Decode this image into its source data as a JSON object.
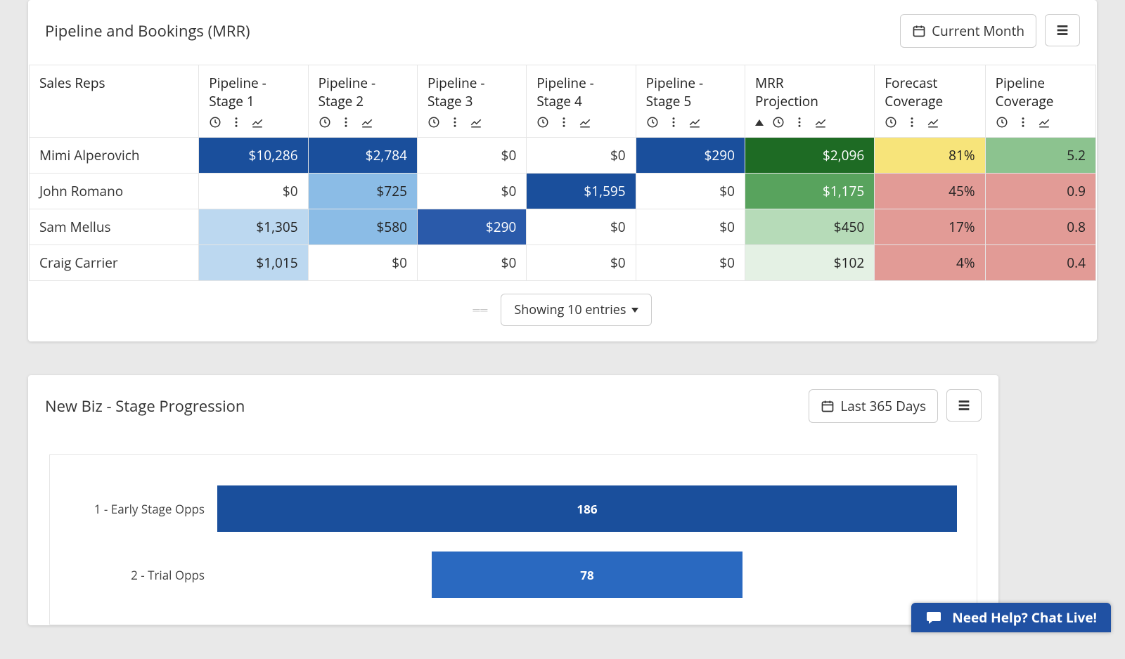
{
  "panel1": {
    "title": "Pipeline and Bookings (MRR)",
    "period": "Current Month",
    "entries_label": "Showing 10 entries",
    "columns": [
      {
        "label": "Sales Reps"
      },
      {
        "label": "Pipeline - Stage 1"
      },
      {
        "label": "Pipeline - Stage 2"
      },
      {
        "label": "Pipeline - Stage 3"
      },
      {
        "label": "Pipeline - Stage 4"
      },
      {
        "label": "Pipeline - Stage 5"
      },
      {
        "label": "MRR Projection",
        "sorted": "asc"
      },
      {
        "label": "Forecast Coverage"
      },
      {
        "label": "Pipeline Coverage"
      }
    ],
    "rows": [
      {
        "name": "Mimi Alperovich",
        "cells": [
          {
            "v": "$10,286",
            "c": "blue-dk"
          },
          {
            "v": "$2,784",
            "c": "blue-dk"
          },
          {
            "v": "$0",
            "c": ""
          },
          {
            "v": "$0",
            "c": ""
          },
          {
            "v": "$290",
            "c": "blue-dk"
          },
          {
            "v": "$2,096",
            "c": "green-dk"
          },
          {
            "v": "81%",
            "c": "yellow"
          },
          {
            "v": "5.2",
            "c": "green-cov"
          }
        ]
      },
      {
        "name": "John Romano",
        "cells": [
          {
            "v": "$0",
            "c": ""
          },
          {
            "v": "$725",
            "c": "blue-lt"
          },
          {
            "v": "$0",
            "c": ""
          },
          {
            "v": "$1,595",
            "c": "blue-dk"
          },
          {
            "v": "$0",
            "c": ""
          },
          {
            "v": "$1,175",
            "c": "green-md"
          },
          {
            "v": "45%",
            "c": "red-lt"
          },
          {
            "v": "0.9",
            "c": "red-lt"
          }
        ]
      },
      {
        "name": "Sam Mellus",
        "cells": [
          {
            "v": "$1,305",
            "c": "blue-lt2"
          },
          {
            "v": "$580",
            "c": "blue-lt"
          },
          {
            "v": "$290",
            "c": "blue-md"
          },
          {
            "v": "$0",
            "c": ""
          },
          {
            "v": "$0",
            "c": ""
          },
          {
            "v": "$450",
            "c": "green-lt"
          },
          {
            "v": "17%",
            "c": "red-lt"
          },
          {
            "v": "0.8",
            "c": "red-lt"
          }
        ]
      },
      {
        "name": "Craig Carrier",
        "cells": [
          {
            "v": "$1,015",
            "c": "blue-lt2"
          },
          {
            "v": "$0",
            "c": ""
          },
          {
            "v": "$0",
            "c": ""
          },
          {
            "v": "$0",
            "c": ""
          },
          {
            "v": "$0",
            "c": ""
          },
          {
            "v": "$102",
            "c": "green-xlt"
          },
          {
            "v": "4%",
            "c": "red-lt"
          },
          {
            "v": "0.4",
            "c": "red-lt"
          }
        ]
      }
    ]
  },
  "panel2": {
    "title": "New Biz - Stage Progression",
    "period": "Last 365 Days"
  },
  "chart_data": {
    "type": "bar",
    "orientation": "horizontal",
    "categories": [
      "1 - Early Stage Opps",
      "2 - Trial Opps"
    ],
    "values": [
      186,
      78
    ],
    "colors": [
      "#1a4f9c",
      "#2a69c0"
    ],
    "xmax": 186,
    "bar_offsets_pct": [
      0,
      29
    ]
  },
  "chat": {
    "label": "Need Help? Chat Live!"
  }
}
